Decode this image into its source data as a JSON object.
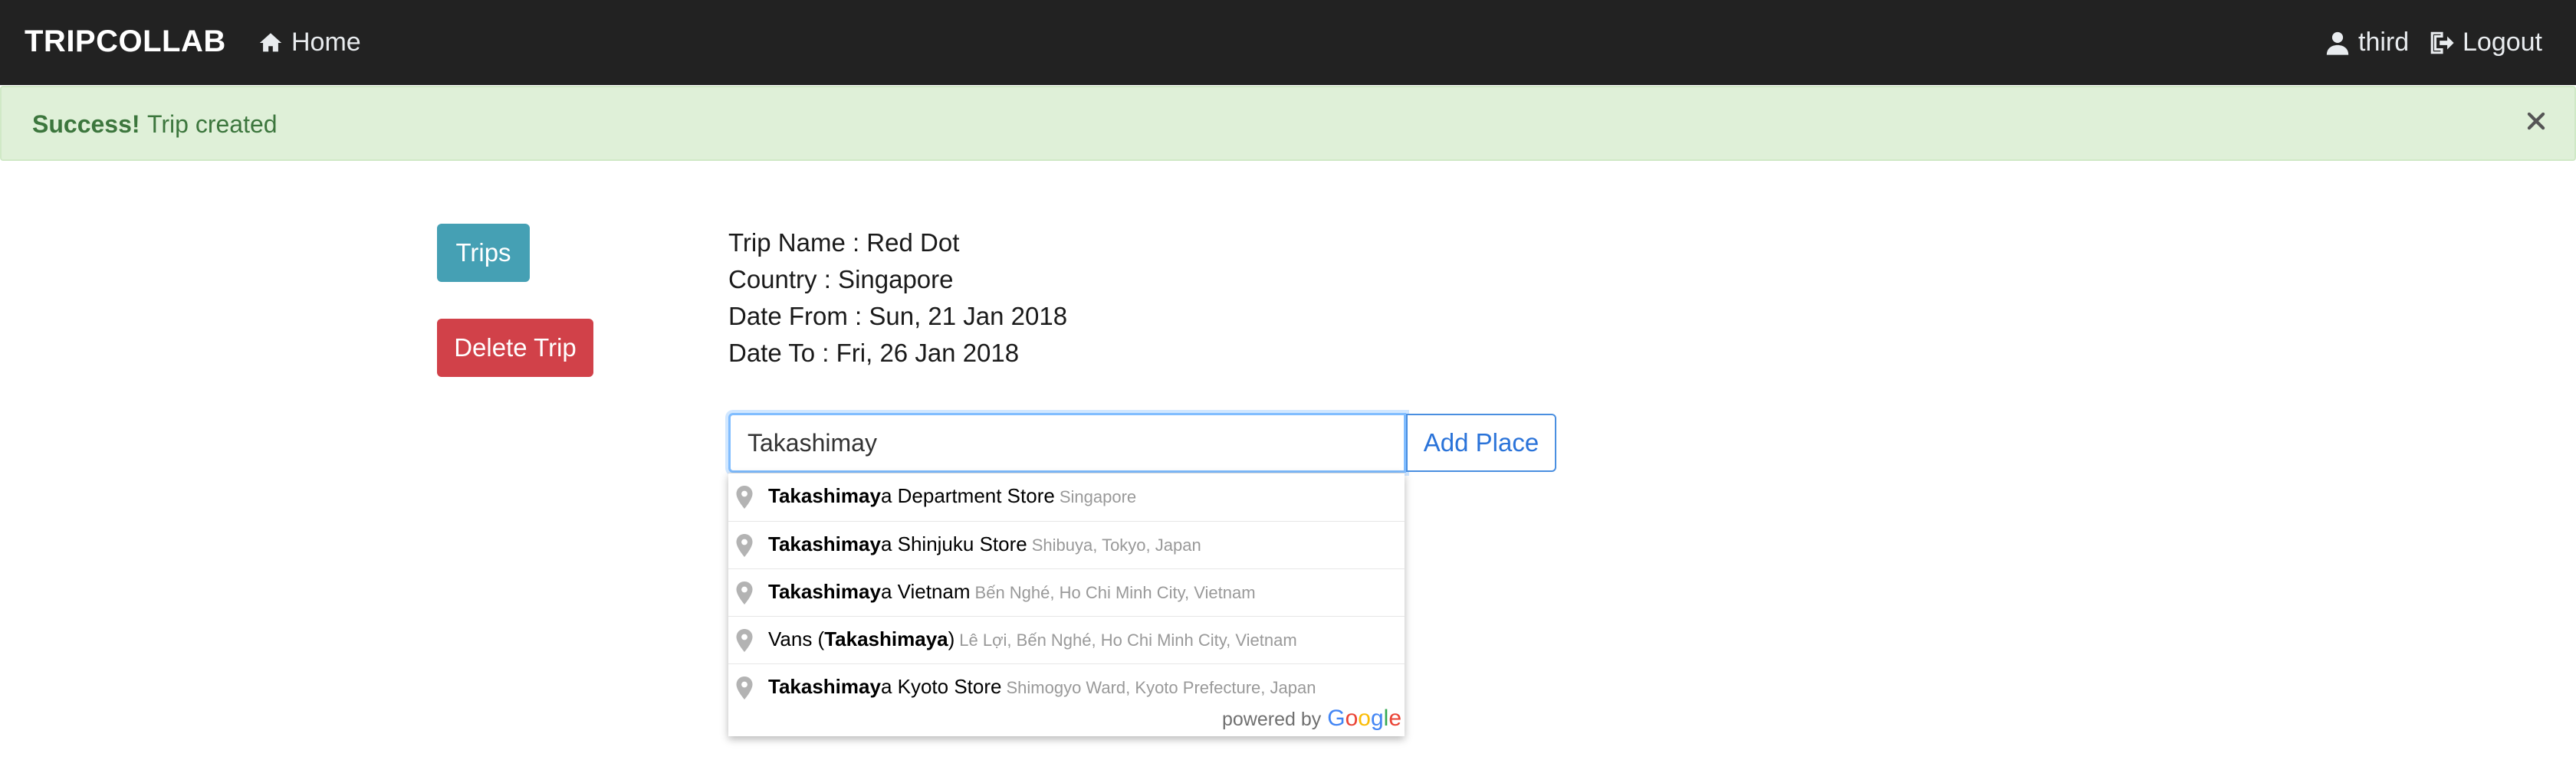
{
  "navbar": {
    "brand": "TRIPCOLLAB",
    "home_label": "Home",
    "user_label": "third",
    "logout_label": "Logout"
  },
  "alert": {
    "strong": "Success!",
    "message": "Trip created"
  },
  "sidebar": {
    "trips_button": "Trips",
    "delete_button": "Delete Trip"
  },
  "trip": {
    "name_line": "Trip Name : Red Dot",
    "country_line": "Country : Singapore",
    "date_from_line": "Date From : Sun, 21 Jan 2018",
    "date_to_line": "Date To : Fri, 26 Jan 2018"
  },
  "place_search": {
    "value": "Takashimay",
    "add_button": "Add Place"
  },
  "suggestions": [
    {
      "before": "",
      "match": "Takashimay",
      "after": "a Department Store",
      "secondary": "Singapore"
    },
    {
      "before": "",
      "match": "Takashimay",
      "after": "a Shinjuku Store",
      "secondary": "Shibuya, Tokyo, Japan"
    },
    {
      "before": "",
      "match": "Takashimay",
      "after": "a Vietnam",
      "secondary": "Bến Nghé, Ho Chi Minh City, Vietnam"
    },
    {
      "before": "Vans (",
      "match": "Takashimaya",
      "after": ")",
      "secondary": "Lê Lợi, Bến Nghé, Ho Chi Minh City, Vietnam"
    },
    {
      "before": "",
      "match": "Takashimay",
      "after": "a Kyoto Store",
      "secondary": "Shimogyo Ward, Kyoto Prefecture, Japan"
    }
  ],
  "attribution": {
    "powered_by": "powered by",
    "google_letters": [
      "G",
      "o",
      "o",
      "g",
      "l",
      "e"
    ]
  },
  "colors": {
    "navbar": "#222222",
    "alert_bg": "#dff0d8",
    "alert_text": "#3c763d",
    "trips_button": "#45a0b4",
    "delete_button": "#d14149",
    "add_place_text": "#2a73d9"
  },
  "icons": {
    "home": "home-icon",
    "user": "user-icon",
    "logout": "logout-icon",
    "close": "close-icon",
    "pin": "map-pin-icon"
  }
}
